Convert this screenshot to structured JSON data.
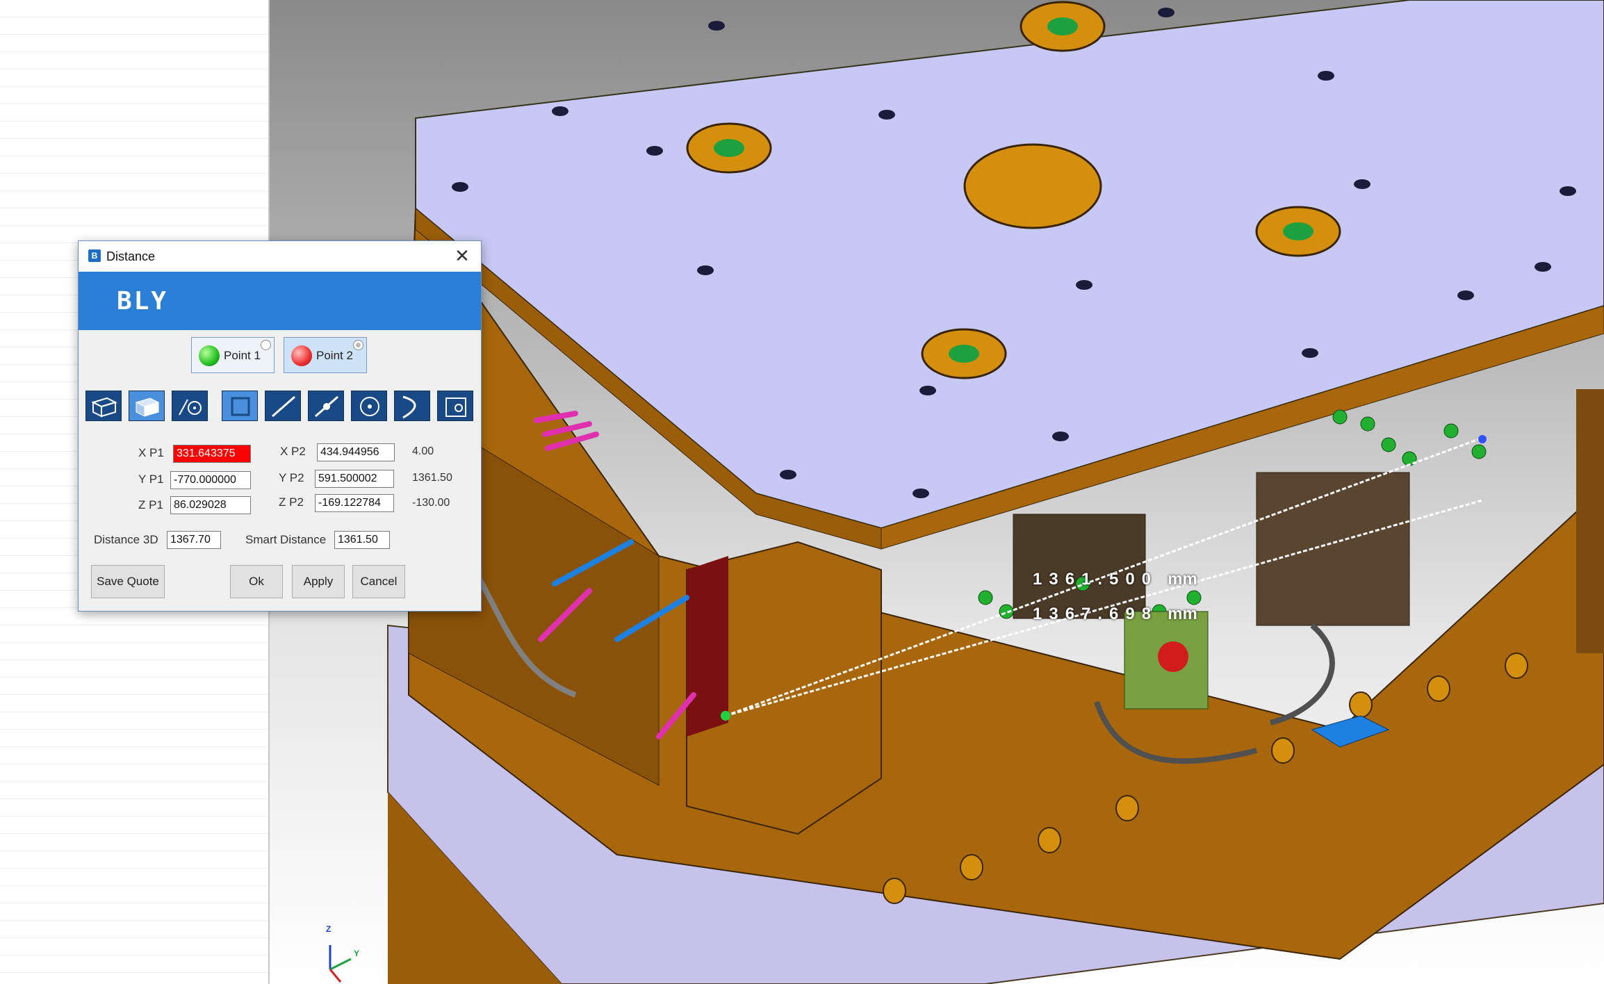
{
  "dialog": {
    "title": "Distance",
    "logo": "BLY",
    "point1_label": "Point 1",
    "point2_label": "Point 2",
    "tools": [
      "box-select-icon",
      "solid-box-icon",
      "arc-point-icon",
      "square-icon",
      "line-icon",
      "line-points-icon",
      "circle-center-icon",
      "arc-icon",
      "face-icon"
    ],
    "x_p1_label": "X P1",
    "x_p1_value": "331.643375",
    "y_p1_label": "Y P1",
    "y_p1_value": "-770.000000",
    "z_p1_label": "Z P1",
    "z_p1_value": "86.029028",
    "x_p2_label": "X P2",
    "x_p2_value": "434.944956",
    "y_p2_label": "Y P2",
    "y_p2_value": "591.500002",
    "z_p2_label": "Z P2",
    "z_p2_value": "-169.122784",
    "delta_x": "4.00",
    "delta_y": "1361.50",
    "delta_z": "-130.00",
    "distance_3d_label": "Distance 3D",
    "distance_3d_value": "1367.70",
    "smart_distance_label": "Smart Distance",
    "smart_distance_value": "1361.50",
    "save_quote": "Save Quote",
    "ok": "Ok",
    "apply": "Apply",
    "cancel": "Cancel"
  },
  "viewport": {
    "measure_1": "1361.500",
    "measure_2": "1367.698",
    "unit": "mm",
    "axis_z": "Z",
    "axis_y": "Y"
  },
  "colors": {
    "plate_top": "#c8c8f4",
    "mold_body": "#a8670c",
    "accent_blue": "#2a7fd4",
    "error_red": "#ff0000"
  }
}
